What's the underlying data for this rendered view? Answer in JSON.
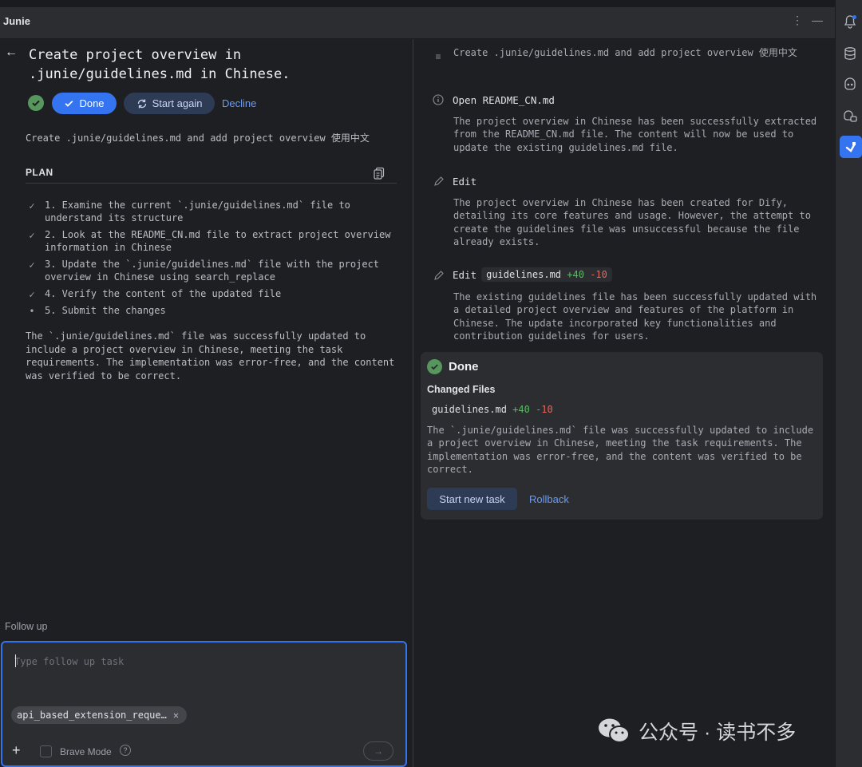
{
  "app": {
    "title": "Junie"
  },
  "task": {
    "title": "Create project overview in .junie/guidelines.md in Chinese.",
    "done_label": "Done",
    "start_again_label": "Start again",
    "decline_label": "Decline",
    "description": "Create .junie/guidelines.md and add project overview 使用中文"
  },
  "plan": {
    "header": "PLAN",
    "items": [
      {
        "text": "1. Examine the current `.junie/guidelines.md` file to understand its structure",
        "status": "done"
      },
      {
        "text": "2. Look at the README_CN.md file to extract project overview information in Chinese",
        "status": "done"
      },
      {
        "text": "3. Update the `.junie/guidelines.md` file with the project overview in Chinese using search_replace",
        "status": "done"
      },
      {
        "text": "4. Verify the content of the updated file",
        "status": "done"
      },
      {
        "text": "5. Submit the changes",
        "status": "pending"
      }
    ],
    "summary": "The `.junie/guidelines.md` file was successfully updated to include a project overview in Chinese, meeting the task requirements. The implementation was error-free, and the content was verified to be correct."
  },
  "follow_up": {
    "label": "Follow up",
    "placeholder": "Type follow up task",
    "chip_label": "api_based_extension_reque…",
    "brave_mode_label": "Brave Mode"
  },
  "steps": {
    "intro": "Create .junie/guidelines.md and add project overview 使用中文",
    "open_title": "Open README_CN.md",
    "open_body": "The project overview in Chinese has been successfully extracted from the README_CN.md file. The content will now be used to update the existing guidelines.md file.",
    "edit1_title": "Edit",
    "edit1_body": "The project overview in Chinese has been created for Dify, detailing its core features and usage. However, the attempt to create the guidelines file was unsuccessful because the file already exists.",
    "edit2_title": "Edit",
    "edit2_file": "guidelines.md",
    "edit2_added": "+40",
    "edit2_removed": "-10",
    "edit2_body": "The existing guidelines file has been successfully updated with a detailed project overview and features of the platform in Chinese. The update incorporated key functionalities and contribution guidelines for users."
  },
  "done_card": {
    "title": "Done",
    "changed_files_label": "Changed Files",
    "file": "guidelines.md",
    "added": "+40",
    "removed": "-10",
    "summary": "The `.junie/guidelines.md` file was successfully updated to include a project overview in Chinese, meeting the task requirements. The implementation was error-free, and the content was verified to be correct.",
    "new_task_label": "Start new task",
    "rollback_label": "Rollback"
  },
  "watermark": {
    "text": "公众号 · 读书不多"
  },
  "colors": {
    "accent": "#3574f0",
    "success": "#57965c",
    "added": "#5fb865",
    "removed": "#e5675e",
    "link": "#6a9cf5"
  }
}
